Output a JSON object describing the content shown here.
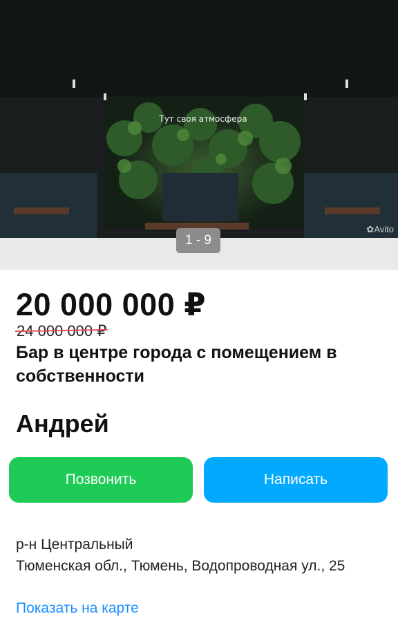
{
  "gallery": {
    "neon_sign": "Тут своя атмосфера",
    "counter": "1 - 9",
    "watermark": "Avito"
  },
  "listing": {
    "price": "20 000 000 ₽",
    "old_price": "24 000 000 ₽",
    "title": "Бар в центре города с помещением в собственности"
  },
  "seller": {
    "name": "Андрей"
  },
  "actions": {
    "call_label": "Позвонить",
    "write_label": "Написать"
  },
  "location": {
    "district": "р-н Центральный",
    "address": "Тюменская обл., Тюмень, Водопроводная ул., 25",
    "map_link": "Показать на карте"
  },
  "colors": {
    "call_button": "#1fcb57",
    "write_button": "#02aaff",
    "strike_line": "#e8505b",
    "link": "#1a8cff"
  }
}
